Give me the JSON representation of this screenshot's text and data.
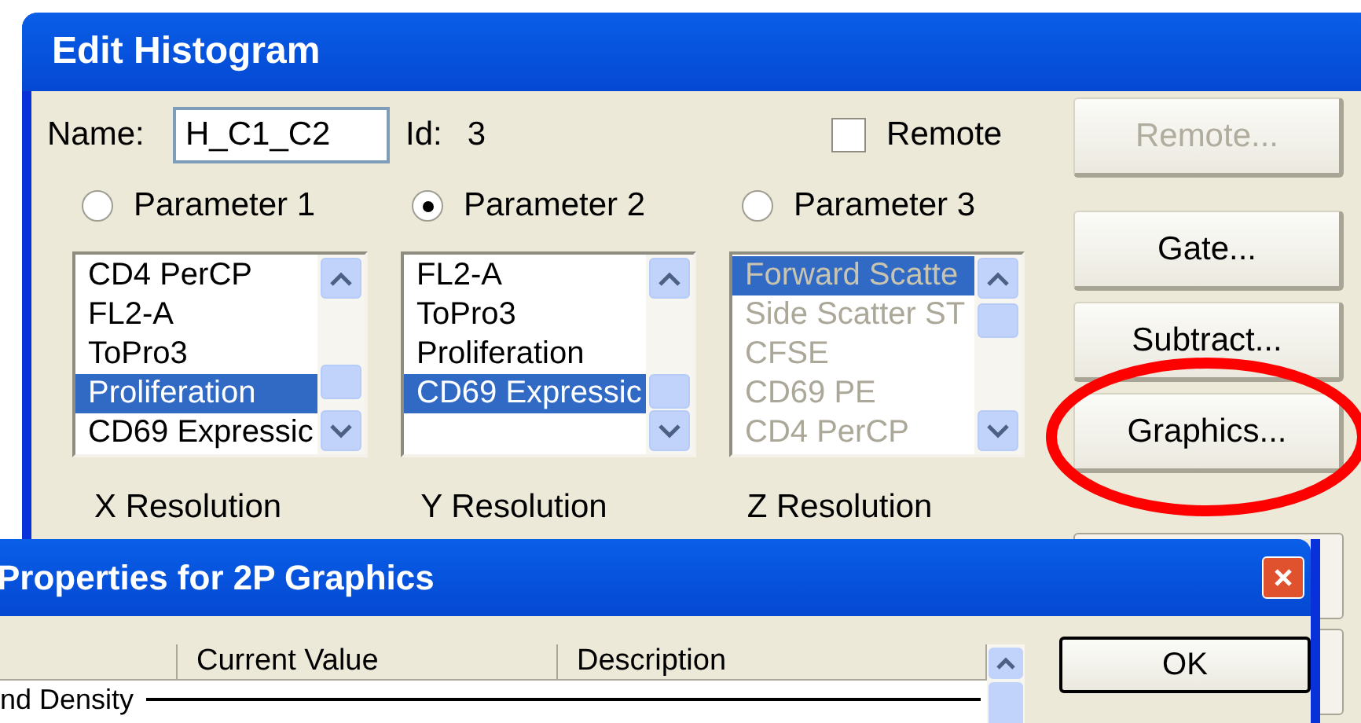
{
  "window": {
    "title": "Edit Histogram"
  },
  "name_field": {
    "label": "Name:",
    "value": "H_C1_C2"
  },
  "id": {
    "label": "Id:",
    "value": "3"
  },
  "remote_checkbox": {
    "label": "Remote",
    "checked": false
  },
  "parameters": [
    {
      "label": "Parameter 1",
      "selected": false,
      "disabled": false,
      "items": [
        {
          "text": "CD4 PerCP",
          "selected": false
        },
        {
          "text": "FL2-A",
          "selected": false
        },
        {
          "text": "ToPro3",
          "selected": false
        },
        {
          "text": "Proliferation",
          "selected": true
        },
        {
          "text": "CD69 Expressic",
          "selected": false
        }
      ]
    },
    {
      "label": "Parameter 2",
      "selected": true,
      "disabled": false,
      "items": [
        {
          "text": "FL2-A",
          "selected": false
        },
        {
          "text": "ToPro3",
          "selected": false
        },
        {
          "text": "Proliferation",
          "selected": false
        },
        {
          "text": "CD69 Expressic",
          "selected": true
        }
      ]
    },
    {
      "label": "Parameter 3",
      "selected": false,
      "disabled": true,
      "items": [
        {
          "text": "Forward Scatte",
          "selected": true
        },
        {
          "text": "Side Scatter ST",
          "selected": false
        },
        {
          "text": "CFSE",
          "selected": false
        },
        {
          "text": "CD69 PE",
          "selected": false
        },
        {
          "text": "CD4 PerCP",
          "selected": false
        }
      ]
    }
  ],
  "resolutions": [
    "X Resolution",
    "Y Resolution",
    "Z Resolution"
  ],
  "buttons": [
    {
      "label": "Remote...",
      "disabled": true,
      "highlighted": false
    },
    {
      "label": "Gate...",
      "disabled": false,
      "highlighted": false
    },
    {
      "label": "Subtract...",
      "disabled": false,
      "highlighted": false
    },
    {
      "label": "Graphics...",
      "disabled": false,
      "highlighted": true
    }
  ],
  "dialog": {
    "title": "Properties for 2P Graphics",
    "columns": [
      "Current Value",
      "Description"
    ],
    "rows": [
      {
        "kind": "category",
        "text": "nd Density"
      }
    ],
    "buttons": [
      "OK"
    ]
  }
}
